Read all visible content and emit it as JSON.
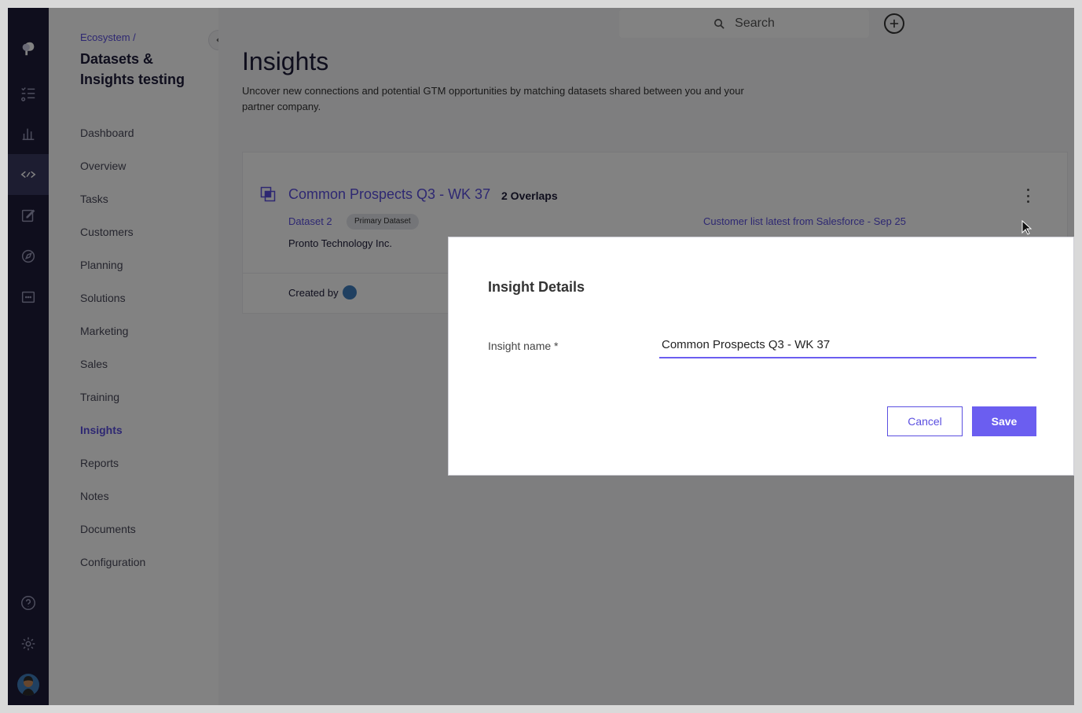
{
  "sidebar": {
    "breadcrumb": "Ecosystem /",
    "workspace_title": "Datasets & Insights testing",
    "nav": [
      {
        "label": "Dashboard"
      },
      {
        "label": "Overview"
      },
      {
        "label": "Tasks"
      },
      {
        "label": "Customers"
      },
      {
        "label": "Planning"
      },
      {
        "label": "Solutions"
      },
      {
        "label": "Marketing"
      },
      {
        "label": "Sales"
      },
      {
        "label": "Training"
      },
      {
        "label": "Insights",
        "active": true
      },
      {
        "label": "Reports"
      },
      {
        "label": "Notes"
      },
      {
        "label": "Documents"
      },
      {
        "label": "Configuration"
      }
    ]
  },
  "header": {
    "search_label": "Search"
  },
  "page": {
    "title": "Insights",
    "description": "Uncover new connections and potential GTM opportunities by matching datasets shared between you and your partner company."
  },
  "card": {
    "title": "Common Prospects Q3 - WK 37",
    "overlaps": "2 Overlaps",
    "dataset": "Dataset 2",
    "badge": "Primary Dataset",
    "company": "Pronto Technology Inc.",
    "source_link": "Customer list latest from Salesforce - Sep 25",
    "created_by": "Created by"
  },
  "modal": {
    "title": "Insight Details",
    "field_label": "Insight name *",
    "field_value": "Common Prospects Q3 - WK 37",
    "cancel_label": "Cancel",
    "save_label": "Save"
  },
  "colors": {
    "accent": "#5b4fe0",
    "rail": "#1e1d3a"
  }
}
